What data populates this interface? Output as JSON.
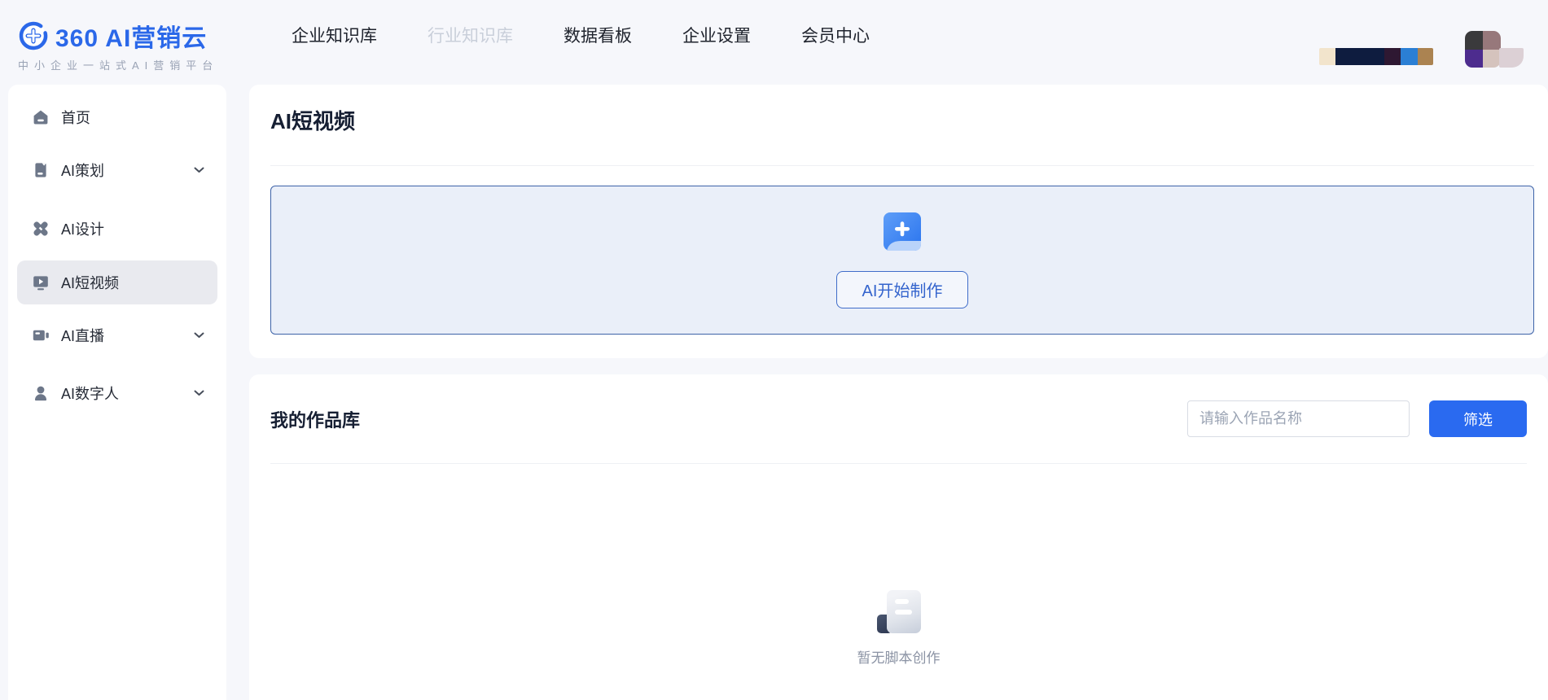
{
  "header": {
    "logo": {
      "title": "360 AI营销云",
      "subtitle": "中小企业一站式AI营销平台"
    },
    "nav": [
      {
        "label": "企业知识库",
        "state": "normal"
      },
      {
        "label": "行业知识库",
        "state": "disabled"
      },
      {
        "label": "数据看板",
        "state": "normal"
      },
      {
        "label": "企业设置",
        "state": "normal"
      },
      {
        "label": "会员中心",
        "state": "normal"
      }
    ],
    "member_banner_segments": [
      "#f2e4cc",
      "#0e1c3f",
      "#2e1832",
      "#2b7fd4",
      "#ab8351"
    ],
    "avatar_colors": [
      "#3a3a3c",
      "#97787b",
      "#4d2c8e",
      "#d5c3bd"
    ]
  },
  "sidebar": {
    "items": [
      {
        "label": "首页",
        "icon": "home-icon",
        "expandable": false,
        "active": false
      },
      {
        "label": "AI策划",
        "icon": "book-icon",
        "expandable": true,
        "active": false
      },
      {
        "label": "AI设计",
        "icon": "design-icon",
        "expandable": false,
        "active": false
      },
      {
        "label": "AI短视频",
        "icon": "video-icon",
        "expandable": false,
        "active": true
      },
      {
        "label": "AI直播",
        "icon": "camera-icon",
        "expandable": true,
        "active": false
      },
      {
        "label": "AI数字人",
        "icon": "person-icon",
        "expandable": true,
        "active": false
      }
    ]
  },
  "main": {
    "page_title": "AI短视频",
    "create_button_label": "AI开始制作",
    "library": {
      "title": "我的作品库",
      "search_placeholder": "请输入作品名称",
      "search_value": "",
      "filter_button_label": "筛选",
      "empty_text": "暂无脚本创作"
    }
  },
  "colors": {
    "accent": "#2a6af0",
    "page_bg": "#f6f7fb",
    "card_bg": "#ffffff",
    "text_primary": "#20242e",
    "text_disabled": "#c9cfda",
    "text_muted": "#8b93a4",
    "sidebar_icon": "#6d7789",
    "sidebar_active_bg": "#e9eaef",
    "box_bg": "#eaeff9",
    "box_border": "#3e63a8",
    "outline_btn_border": "#3f6cc9",
    "outline_btn_text": "#3464cd",
    "brand_blue": "#2b68e9",
    "divider": "#eef0f4",
    "input_border": "#d8dce4",
    "placeholder": "#9ba4b4"
  }
}
